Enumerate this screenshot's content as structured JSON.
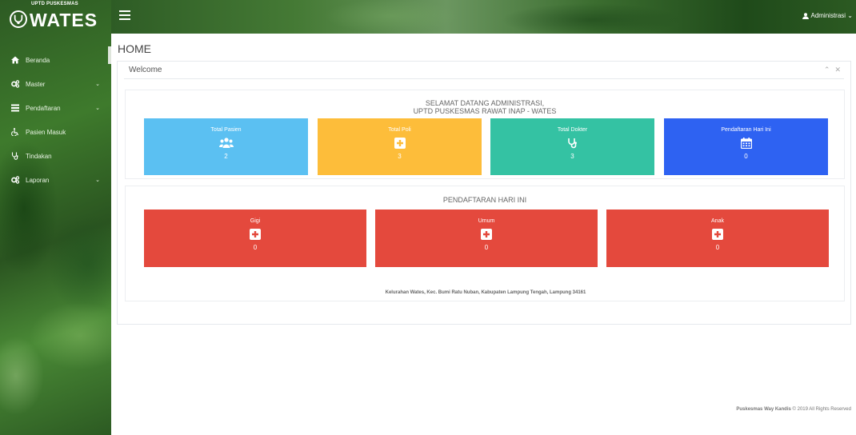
{
  "brand": {
    "top_text": "UPTD PUSKESMAS",
    "name": "WATES"
  },
  "sidebar": {
    "items": [
      {
        "label": "Beranda",
        "icon": "home-icon",
        "has_children": false
      },
      {
        "label": "Master",
        "icon": "cogs-icon",
        "has_children": true
      },
      {
        "label": "Pendaftaran",
        "icon": "table-icon",
        "has_children": true
      },
      {
        "label": "Pasien Masuk",
        "icon": "wheelchair-icon",
        "has_children": false
      },
      {
        "label": "Tindakan",
        "icon": "stethoscope-icon",
        "has_children": false
      },
      {
        "label": "Laporan",
        "icon": "cogs-icon",
        "has_children": true
      }
    ]
  },
  "topbar": {
    "user_label": "Administrasi"
  },
  "page": {
    "title": "HOME"
  },
  "panel": {
    "title": "Welcome",
    "welcome_line1": "SELAMAT DATANG ADMINISTRASI,",
    "welcome_line2": "UPTD PUSKESMAS RAWAT INAP - WATES",
    "stats": [
      {
        "label": "Total Pasien",
        "value": "2",
        "color": "#5bc0f2",
        "icon": "users-icon"
      },
      {
        "label": "Total Poli",
        "value": "3",
        "color": "#fdbd3a",
        "icon": "plus-square-icon"
      },
      {
        "label": "Total Dokter",
        "value": "3",
        "color": "#34c2a3",
        "icon": "stethoscope-icon"
      },
      {
        "label": "Pendaftaran Hari Ini",
        "value": "0",
        "color": "#2e62f2",
        "icon": "calendar-icon"
      }
    ],
    "today_heading": "PENDAFTARAN HARI INI",
    "polis": [
      {
        "label": "Gigi",
        "value": "0",
        "color": "#e4493d",
        "icon": "plus-square-icon"
      },
      {
        "label": "Umum",
        "value": "0",
        "color": "#e4493d",
        "icon": "plus-square-icon"
      },
      {
        "label": "Anak",
        "value": "0",
        "color": "#e4493d",
        "icon": "plus-square-icon"
      }
    ],
    "address": "Kelurahan Wates, Kec. Bumi Ratu Nuban, Kabupaten Lampung Tengah, Lampung 34161"
  },
  "footer": {
    "org": "Puskesmas Way Kandis",
    "rest": " © 2019 All Rights Reserved"
  }
}
